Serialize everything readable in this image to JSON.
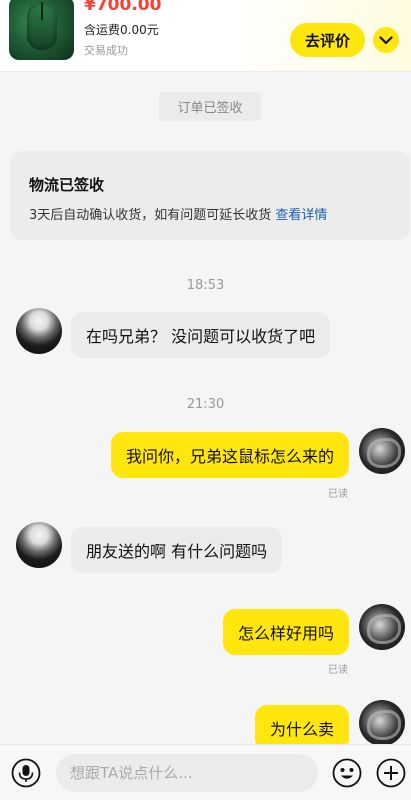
{
  "order": {
    "price": "¥700.00",
    "shipping": "含运费0.00元",
    "status": "交易成功",
    "review_label": "去评价",
    "thumbnail_icon": "gaming-mouse-photo",
    "collapse_icon": "chevron-down-icon"
  },
  "system_notice": "订单已签收",
  "logistics": {
    "title": "物流已签收",
    "desc": "3天后自动确认收货，如有问题可延长收货",
    "link": "查看详情"
  },
  "timestamps": [
    "18:53",
    "21:30"
  ],
  "messages": [
    {
      "from": "peer",
      "text": "在吗兄弟？ 没问题可以收货了吧"
    },
    {
      "from": "self",
      "text": "我问你，兄弟这鼠标怎么来的",
      "status": "已读"
    },
    {
      "from": "peer",
      "text": "朋友送的啊 有什么问题吗"
    },
    {
      "from": "self",
      "text": "怎么样好用吗",
      "status": "已读"
    },
    {
      "from": "self",
      "text": "为什么卖"
    }
  ],
  "input": {
    "placeholder": "想跟TA说点什么...",
    "voice_icon": "microphone-icon",
    "emoji_icon": "emoji-smile-icon",
    "plus_icon": "plus-circle-icon"
  },
  "colors": {
    "accent_yellow": "#ffe60f",
    "price_red": "#ff3d2e",
    "link_blue": "#1a5fb4",
    "page_bg": "#f5f5f5"
  }
}
